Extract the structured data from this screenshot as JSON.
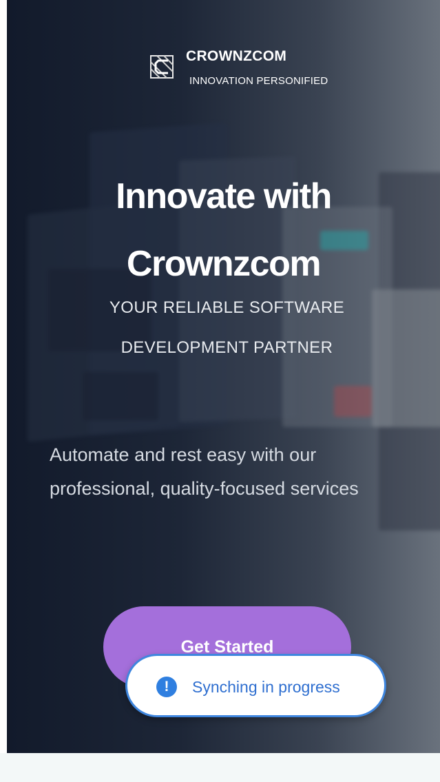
{
  "brand": {
    "name": "CROWNZCOM",
    "tagline": "INNOVATION PERSONIFIED",
    "logo_icon": "crownzcom-logo-mark"
  },
  "hero": {
    "headline": [
      "Innovate with",
      "Crownzcom"
    ],
    "subtitle": [
      "YOUR RELIABLE SOFTWARE",
      "DEVELOPMENT PARTNER"
    ],
    "description": "Automate and rest easy with our professional, quality-focused services",
    "cta_label": "Get Started"
  },
  "toast": {
    "icon": "exclamation-circle-icon",
    "icon_glyph": "!",
    "message": "Synching in progress"
  },
  "colors": {
    "cta": "#a46fdb",
    "toast_border": "#3f86de",
    "toast_text": "#2f6fd0",
    "hero_dark": "#121a2b"
  }
}
